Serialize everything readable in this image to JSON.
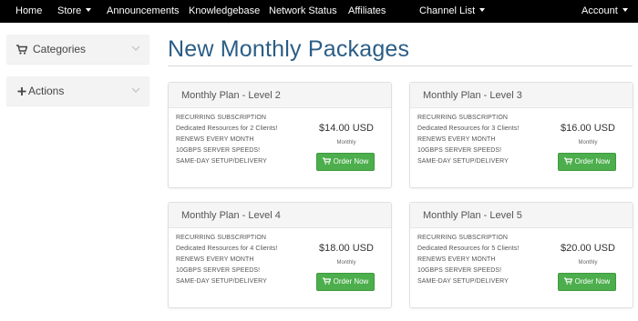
{
  "nav": {
    "home": "Home",
    "store": "Store",
    "announcements": "Announcements",
    "knowledgebase": "Knowledgebase",
    "network_status": "Network Status",
    "affiliates": "Affiliates",
    "channel_list": "Channel List",
    "account": "Account"
  },
  "sidebar": {
    "categories": {
      "label": "Categories",
      "icon": "cart-icon"
    },
    "actions": {
      "label": "Actions",
      "icon": "plus-icon"
    }
  },
  "page_title": "New Monthly Packages",
  "order_button_label": "Order Now",
  "colors": {
    "navbar": "#000000",
    "title": "#2b5d86",
    "order_button": "#4cae4c"
  },
  "packages": [
    {
      "title": "Monthly Plan - Level 2",
      "features": [
        "RECURRING SUBSCRIPTION",
        "Dedicated Resources for 2 Clients!",
        "RENEWS EVERY MONTH",
        "10GBPS SERVER SPEEDS!",
        "SAME-DAY SETUP/DELIVERY"
      ],
      "price": "$14.00 USD",
      "cycle": "Monthly"
    },
    {
      "title": "Monthly Plan - Level 3",
      "features": [
        "RECURRING SUBSCRIPTION",
        "Dedicated Resources for 3 Clients!",
        "RENEWS EVERY MONTH",
        "10GBPS SERVER SPEEDS!",
        "SAME-DAY SETUP/DELIVERY"
      ],
      "price": "$16.00 USD",
      "cycle": "Monthly"
    },
    {
      "title": "Monthly Plan - Level 4",
      "features": [
        "RECURRING SUBSCRIPTION",
        "Dedicated Resources for 4 Clients!",
        "RENEWS EVERY MONTH",
        "10GBPS SERVER SPEEDS!",
        "SAME-DAY SETUP/DELIVERY"
      ],
      "price": "$18.00 USD",
      "cycle": "Monthly"
    },
    {
      "title": "Monthly Plan - Level 5",
      "features": [
        "RECURRING SUBSCRIPTION",
        "Dedicated Resources for 5 Clients!",
        "RENEWS EVERY MONTH",
        "10GBPS SERVER SPEEDS!",
        "SAME-DAY SETUP/DELIVERY"
      ],
      "price": "$20.00 USD",
      "cycle": "Monthly"
    }
  ]
}
